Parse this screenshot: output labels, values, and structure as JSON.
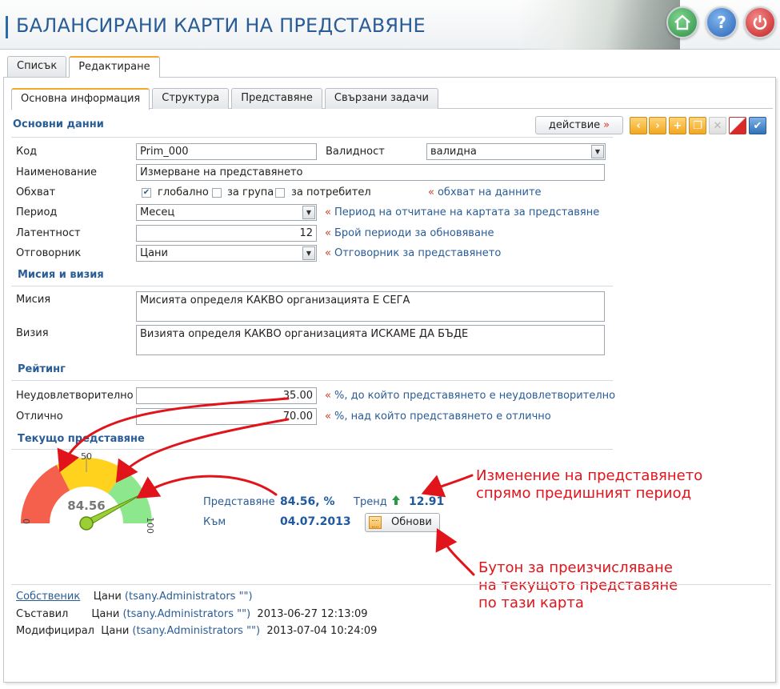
{
  "app": {
    "title": "БАЛАНСИРАНИ КАРТИ НА ПРЕДСТАВЯНЕ"
  },
  "colors": {
    "accent": "#2a5c96",
    "hint_marker": "#d23a1d",
    "annotation": "#e1141b",
    "gauge_red": "#f4604c",
    "gauge_yellow": "#ffd21e",
    "gauge_green": "#8de88d",
    "needle": "#9bcf35"
  },
  "header": {
    "home_icon": "house-icon",
    "help_icon": "question-icon",
    "power_icon": "power-icon"
  },
  "outer_tabs": [
    {
      "label": "Списък"
    },
    {
      "label": "Редактиране"
    }
  ],
  "inner_tabs": [
    {
      "label": "Основна информация"
    },
    {
      "label": "Структура"
    },
    {
      "label": "Представяне"
    },
    {
      "label": "Свързани задачи"
    }
  ],
  "toolbar": {
    "action_label": "действие",
    "action_chevron": "»"
  },
  "sections": {
    "basic": "Основни данни",
    "mission": "Мисия и визия",
    "rating": "Рейтинг",
    "current": "Текущо представяне"
  },
  "form": {
    "code": {
      "label": "Код",
      "value": "Prim_000"
    },
    "validity": {
      "label": "Валидност",
      "value": "валидна"
    },
    "name": {
      "label": "Наименование",
      "value": "Измерване на представянето"
    },
    "scope": {
      "label": "Обхват",
      "options": [
        {
          "label": "глобално",
          "checked": true
        },
        {
          "label": "за група",
          "checked": false
        },
        {
          "label": "за потребител",
          "checked": false
        }
      ],
      "hint": "обхват на данните"
    },
    "period": {
      "label": "Период",
      "value": "Месец",
      "hint": "Период на отчитане на картата за представяне"
    },
    "latency": {
      "label": "Латентност",
      "value": "12",
      "hint": "Брой периоди за обновяване"
    },
    "owner": {
      "label": "Отговорник",
      "value": "Цани",
      "hint": "Отговорник за представянето"
    },
    "mission": {
      "label": "Мисия",
      "value": "Мисията определя КАКВО организацията Е СЕГА"
    },
    "vision": {
      "label": "Визия",
      "value": "Визията определя КАКВО организацията ИСКАМЕ ДА БЪДЕ"
    },
    "unsatisfactory": {
      "label": "Неудовлетворително",
      "value": "35.00",
      "hint": "%, до който представянето е неудовлетворително"
    },
    "excellent": {
      "label": "Отлично",
      "value": "70.00",
      "hint": "%, над който представянето е отлично"
    }
  },
  "gauge": {
    "min": "0",
    "mid": "50",
    "max": "100",
    "value": 84.56,
    "value_label": "84.56",
    "thresholds": [
      35,
      70
    ]
  },
  "current": {
    "performance_label": "Представяне",
    "performance_value": "84.56, %",
    "as_of_label": "Към",
    "as_of_value": "04.07.2013",
    "trend_label": "Тренд",
    "trend_icon": "arrow-up-icon",
    "trend_value": "12.91",
    "refresh_label": "Обнови"
  },
  "annotations": {
    "trend_note_1": "Изменение на представянето",
    "trend_note_2": "спрямо предишният период",
    "refresh_note_1": "Бутон за преизчисляване",
    "refresh_note_2": "на текущото представяне",
    "refresh_note_3": "по тази карта"
  },
  "footer": {
    "owner": {
      "label": "Собственик",
      "name": "Цани",
      "user": "(tsany.Administrators \"\")"
    },
    "created": {
      "label": "Съставил",
      "name": "Цани",
      "user": "(tsany.Administrators \"\")",
      "date": "2013-06-27 12:13:09"
    },
    "modified": {
      "label": "Модифицирал",
      "name": "Цани",
      "user": "(tsany.Administrators \"\")",
      "date": "2013-07-04 10:24:09"
    }
  }
}
